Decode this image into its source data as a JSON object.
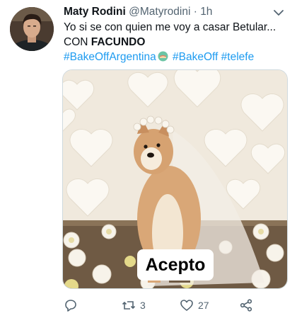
{
  "author": {
    "name": "Maty Rodini",
    "handle": "@Matyrodini",
    "separator": "·",
    "time": "1h"
  },
  "tweet": {
    "line1": "Yo si se con quien me voy a casar Betular...",
    "line2_prefix": "CON ",
    "line2_bold": "FACUNDO",
    "hashtags": [
      "#BakeOffArgentina",
      "#BakeOff",
      "#telefe"
    ]
  },
  "media": {
    "caption": "Acepto"
  },
  "actions": {
    "reply_icon": "reply-icon",
    "retweet_icon": "retweet-icon",
    "retweet_count": "3",
    "like_icon": "heart-icon",
    "like_count": "27",
    "share_icon": "share-icon"
  },
  "colors": {
    "text": "#0f1419",
    "secondary": "#536471",
    "link": "#1d9bf0"
  }
}
